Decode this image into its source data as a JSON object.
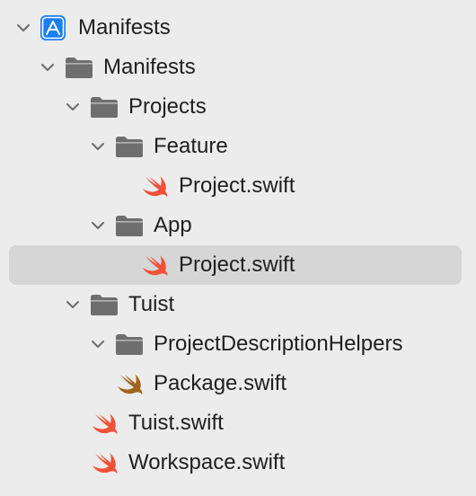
{
  "navigator": {
    "colors": {
      "background": "#ececec",
      "selection": "#d6d6d6",
      "text": "#1f1f1f",
      "chevron": "#6b6b6b",
      "folder": "#6e6e6e",
      "swift": "#f05138",
      "swift_package": "#a0641e",
      "project_icon": "#1b7ef2"
    },
    "items": [
      {
        "label": "Manifests",
        "icon": "xcode-project-icon",
        "expanded": true,
        "selected": false
      },
      {
        "label": "Manifests",
        "icon": "folder-icon",
        "expanded": true,
        "selected": false
      },
      {
        "label": "Projects",
        "icon": "folder-icon",
        "expanded": true,
        "selected": false
      },
      {
        "label": "Feature",
        "icon": "folder-icon",
        "expanded": true,
        "selected": false
      },
      {
        "label": "Project.swift",
        "icon": "swift-file-icon",
        "expanded": null,
        "selected": false
      },
      {
        "label": "App",
        "icon": "folder-icon",
        "expanded": true,
        "selected": false
      },
      {
        "label": "Project.swift",
        "icon": "swift-file-icon",
        "expanded": null,
        "selected": true
      },
      {
        "label": "Tuist",
        "icon": "folder-icon",
        "expanded": true,
        "selected": false
      },
      {
        "label": "ProjectDescriptionHelpers",
        "icon": "folder-icon",
        "expanded": true,
        "selected": false
      },
      {
        "label": "Package.swift",
        "icon": "swift-package-icon",
        "expanded": null,
        "selected": false
      },
      {
        "label": "Tuist.swift",
        "icon": "swift-file-icon",
        "expanded": null,
        "selected": false
      },
      {
        "label": "Workspace.swift",
        "icon": "swift-file-icon",
        "expanded": null,
        "selected": false
      }
    ]
  }
}
